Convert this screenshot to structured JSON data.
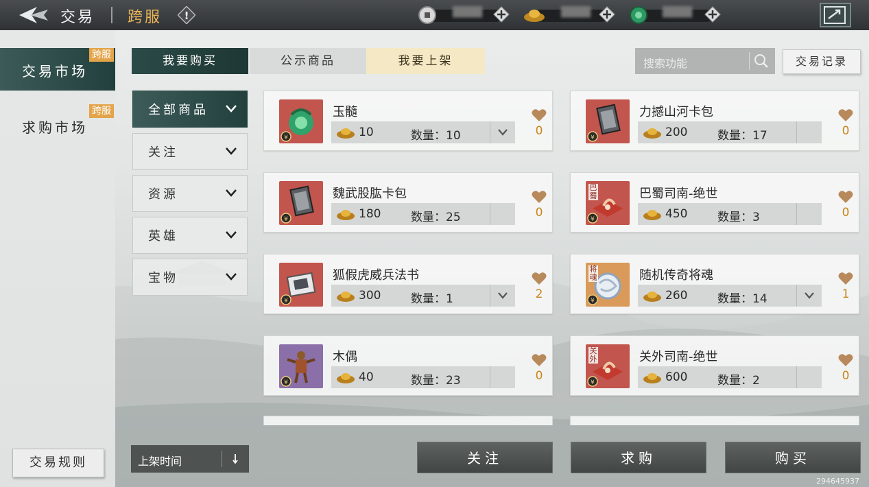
{
  "header": {
    "title": "交易",
    "subtitle": "跨服",
    "currencies": [
      {
        "icon": "coin-icon",
        "value": "████"
      },
      {
        "icon": "gold-ingot-icon",
        "value": "████"
      },
      {
        "icon": "jade-icon",
        "value": "████"
      }
    ]
  },
  "sidebar": {
    "items": [
      {
        "label": "交易市场",
        "badge": "跨服",
        "active": true
      },
      {
        "label": "求购市场",
        "badge": "跨服",
        "active": false
      }
    ],
    "rules_button": "交易规则"
  },
  "tabs": [
    {
      "label": "我要购买",
      "active": true
    },
    {
      "label": "公示商品",
      "active": false
    },
    {
      "label": "我要上架",
      "active": false
    }
  ],
  "search": {
    "placeholder": "搜索功能"
  },
  "record_button": "交易记录",
  "filters": [
    {
      "label": "全部商品",
      "active": true
    },
    {
      "label": "关注",
      "active": false
    },
    {
      "label": "资源",
      "active": false
    },
    {
      "label": "英雄",
      "active": false
    },
    {
      "label": "宝物",
      "active": false
    }
  ],
  "qty_label": "数量：",
  "items": [
    {
      "name": "玉髓",
      "price": "10",
      "qty": "10",
      "likes": "0",
      "dropdown": true,
      "badge": "",
      "icon": "jade-dragon-icon",
      "bg": "#c2554d"
    },
    {
      "name": "力撼山河卡包",
      "price": "200",
      "qty": "17",
      "likes": "0",
      "dropdown": false,
      "badge": "",
      "icon": "card-pack-icon",
      "bg": "#c2554d"
    },
    {
      "name": "魏武股肱卡包",
      "price": "180",
      "qty": "25",
      "likes": "0",
      "dropdown": false,
      "badge": "",
      "icon": "card-pack-icon",
      "bg": "#c2554d"
    },
    {
      "name": "巴蜀司南-绝世",
      "price": "450",
      "qty": "3",
      "likes": "0",
      "dropdown": false,
      "badge": "巴蜀",
      "icon": "compass-icon",
      "bg": "#c2554d"
    },
    {
      "name": "狐假虎威兵法书",
      "price": "300",
      "qty": "1",
      "likes": "2",
      "dropdown": true,
      "badge": "",
      "icon": "scroll-book-icon",
      "bg": "#c2554d"
    },
    {
      "name": "随机传奇将魂",
      "price": "260",
      "qty": "14",
      "likes": "1",
      "dropdown": true,
      "badge": "将魂",
      "icon": "soul-orb-icon",
      "bg": "#d99a5a"
    },
    {
      "name": "木偶",
      "price": "40",
      "qty": "23",
      "likes": "0",
      "dropdown": false,
      "badge": "",
      "icon": "puppet-icon",
      "bg": "#8a6fa8"
    },
    {
      "name": "关外司南-绝世",
      "price": "600",
      "qty": "2",
      "likes": "0",
      "dropdown": false,
      "badge": "关外",
      "icon": "compass-icon",
      "bg": "#c2554d"
    }
  ],
  "sort": {
    "label": "上架时间"
  },
  "bottom_buttons": [
    "关注",
    "求购",
    "购买"
  ],
  "uid": "294645937"
}
